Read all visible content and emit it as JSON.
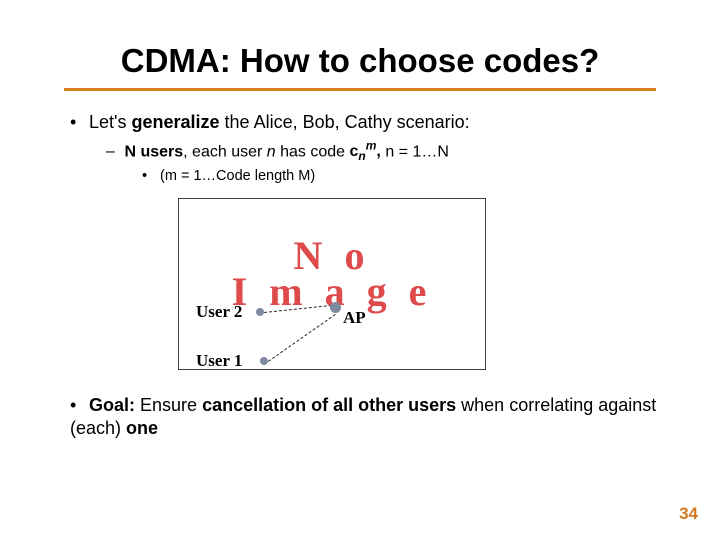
{
  "title": "CDMA: How to choose codes?",
  "bullets": {
    "level1a_prefix": "•",
    "level1a_text1": "Let's ",
    "level1a_bold": "generalize",
    "level1a_text2": " the Alice, Bob, Cathy scenario:",
    "level2a_prefix": "–",
    "level2a_bold1": "N users",
    "level2a_text1": ", each user ",
    "level2a_ital1": "n",
    "level2a_text2": " has code ",
    "level2a_code": "cₙᵐ,",
    "level2a_text3": " n = 1…N",
    "level3a_prefix": "•",
    "level3a_text": "(m = 1…Code length M)"
  },
  "diagram": {
    "placeholder_line1": "N o",
    "placeholder_line2": "I m a g e",
    "user2": "User 2",
    "user1": "User 1",
    "ap": "AP"
  },
  "goal": {
    "prefix": "•",
    "bold1": "Goal:",
    "text1": " Ensure ",
    "bold2": "cancellation of all other users",
    "text2": " when correlating against (each) ",
    "bold3": "one"
  },
  "slide_number": "34"
}
